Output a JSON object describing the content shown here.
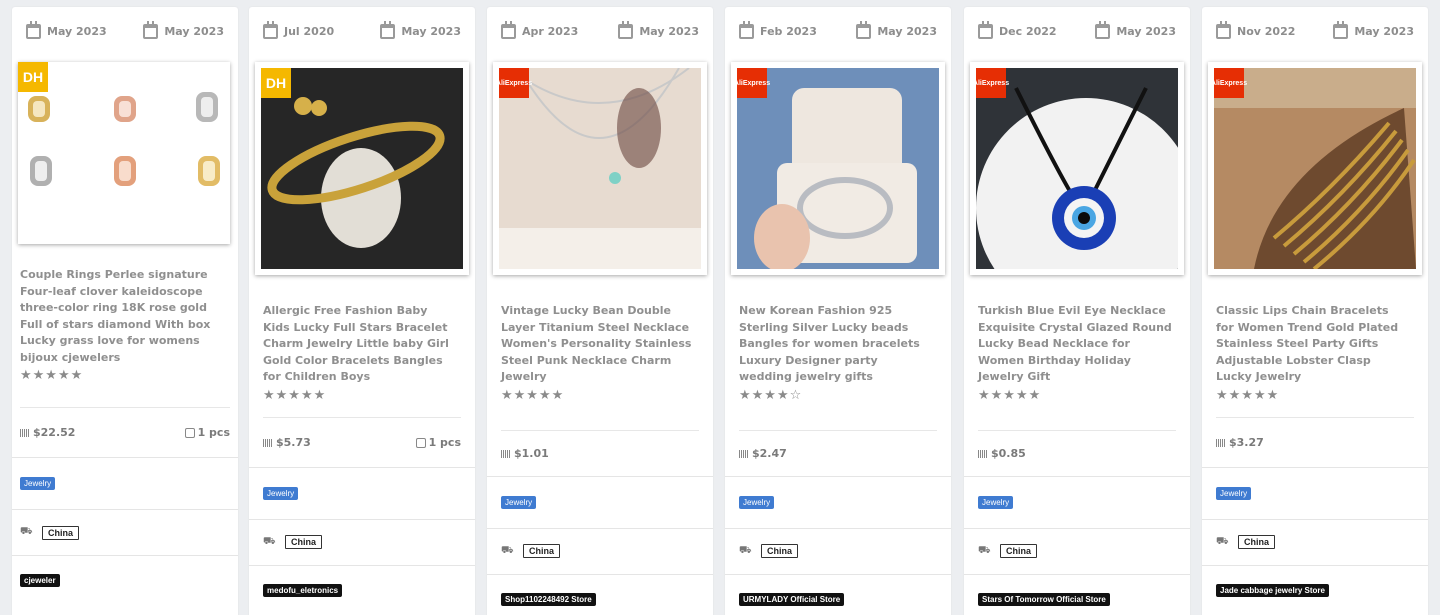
{
  "products": [
    {
      "date_left": "May 2023",
      "date_right": "May 2023",
      "badge": "DH",
      "badge_kind": "dh",
      "title": "Couple Rings Perlee signature Four-leaf clover kaleidoscope three-color ring 18K rose gold Full of stars diamond With box Lucky grass love for womens bijoux cjewelers",
      "stars": "★★★★★",
      "price": "$22.52",
      "qty": "1 pcs",
      "category": "Jewelry",
      "country": "China",
      "store": "cjeweler"
    },
    {
      "date_left": "Jul 2020",
      "date_right": "May 2023",
      "badge": "DH",
      "badge_kind": "dh",
      "title": "Allergic Free Fashion Baby Kids Lucky Full Stars Bracelet Charm Jewelry Little baby Girl Gold Color Bracelets Bangles for Children Boys",
      "stars": "★★★★★",
      "price": "$5.73",
      "qty": "1 pcs",
      "category": "Jewelry",
      "country": "China",
      "store": "medofu_eletronics"
    },
    {
      "date_left": "Apr 2023",
      "date_right": "May 2023",
      "badge": "AliExpress",
      "badge_kind": "ali",
      "title": "Vintage Lucky Bean Double Layer Titanium Steel Necklace Women's Personality Stainless Steel Punk Necklace Charm Jewelry",
      "stars": "★★★★★",
      "price": "$1.01",
      "qty": "",
      "category": "Jewelry",
      "country": "China",
      "store": "Shop1102248492 Store"
    },
    {
      "date_left": "Feb 2023",
      "date_right": "May 2023",
      "badge": "AliExpress",
      "badge_kind": "ali",
      "title": "New Korean Fashion 925 Sterling Silver Lucky beads Bangles for women bracelets Luxury Designer party wedding jewelry gifts",
      "stars": "★★★★☆",
      "price": "$2.47",
      "qty": "",
      "category": "Jewelry",
      "country": "China",
      "store": "URMYLADY Official Store"
    },
    {
      "date_left": "Dec 2022",
      "date_right": "May 2023",
      "badge": "AliExpress",
      "badge_kind": "ali",
      "title": "Turkish Blue Evil Eye Necklace Exquisite Crystal Glazed Round Lucky Bead Necklace for Women Birthday Holiday Jewelry Gift",
      "stars": "★★★★★",
      "price": "$0.85",
      "qty": "",
      "category": "Jewelry",
      "country": "China",
      "store": "Stars Of Tomorrow Official Store"
    },
    {
      "date_left": "Nov 2022",
      "date_right": "May 2023",
      "badge": "AliExpress",
      "badge_kind": "ali",
      "title": "Classic Lips Chain Bracelets for Women Trend Gold Plated Stainless Steel Party Gifts Adjustable Lobster Clasp Lucky Jewelry",
      "stars": "★★★★★",
      "price": "$3.27",
      "qty": "",
      "category": "Jewelry",
      "country": "China",
      "store": "Jade cabbage jewelry Store"
    }
  ],
  "colors": {
    "tag": "#3f7bd1",
    "store": "#111111",
    "aliexpress": "#e62e04",
    "dhgate": "#f5b800"
  }
}
